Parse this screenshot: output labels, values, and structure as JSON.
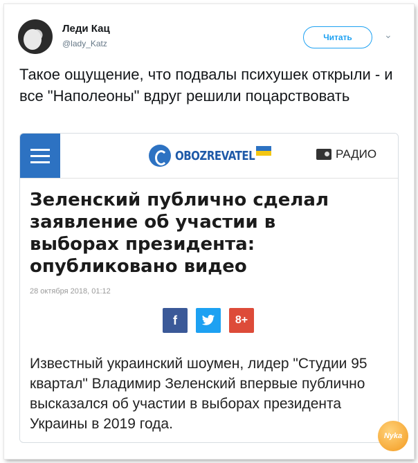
{
  "tweet": {
    "author_name": "Леди Кац",
    "author_handle": "@lady_Katz",
    "follow_label": "Читать",
    "caret_icon": "chevron-down-icon",
    "text": "Такое ощущение, что подвалы психушек открыли - и все \"Наполеоны\" вдруг решили поцарствовать"
  },
  "article": {
    "site_name": "OBOZREVATEL",
    "site_flag": "UA",
    "radio_label": "РАДИО",
    "headline": "Зеленский публично сделал заявление об участии в выборах президента: опубликовано видео",
    "date": "28 октября 2018, 01:12",
    "share": {
      "facebook": "f",
      "twitter": "🐦",
      "googleplus": "8+"
    },
    "lead": "Известный украинский шоумен, лидер \"Студии 95 квартал\" Владимир Зеленский впервые публично высказался об участии в выборах президента Украины в 2019 года."
  },
  "watermark": "Nyka",
  "colors": {
    "twitter_blue": "#1da1f2",
    "obozrevatel_blue": "#2d72c2",
    "facebook": "#3b5998",
    "googleplus": "#dd4b39"
  }
}
